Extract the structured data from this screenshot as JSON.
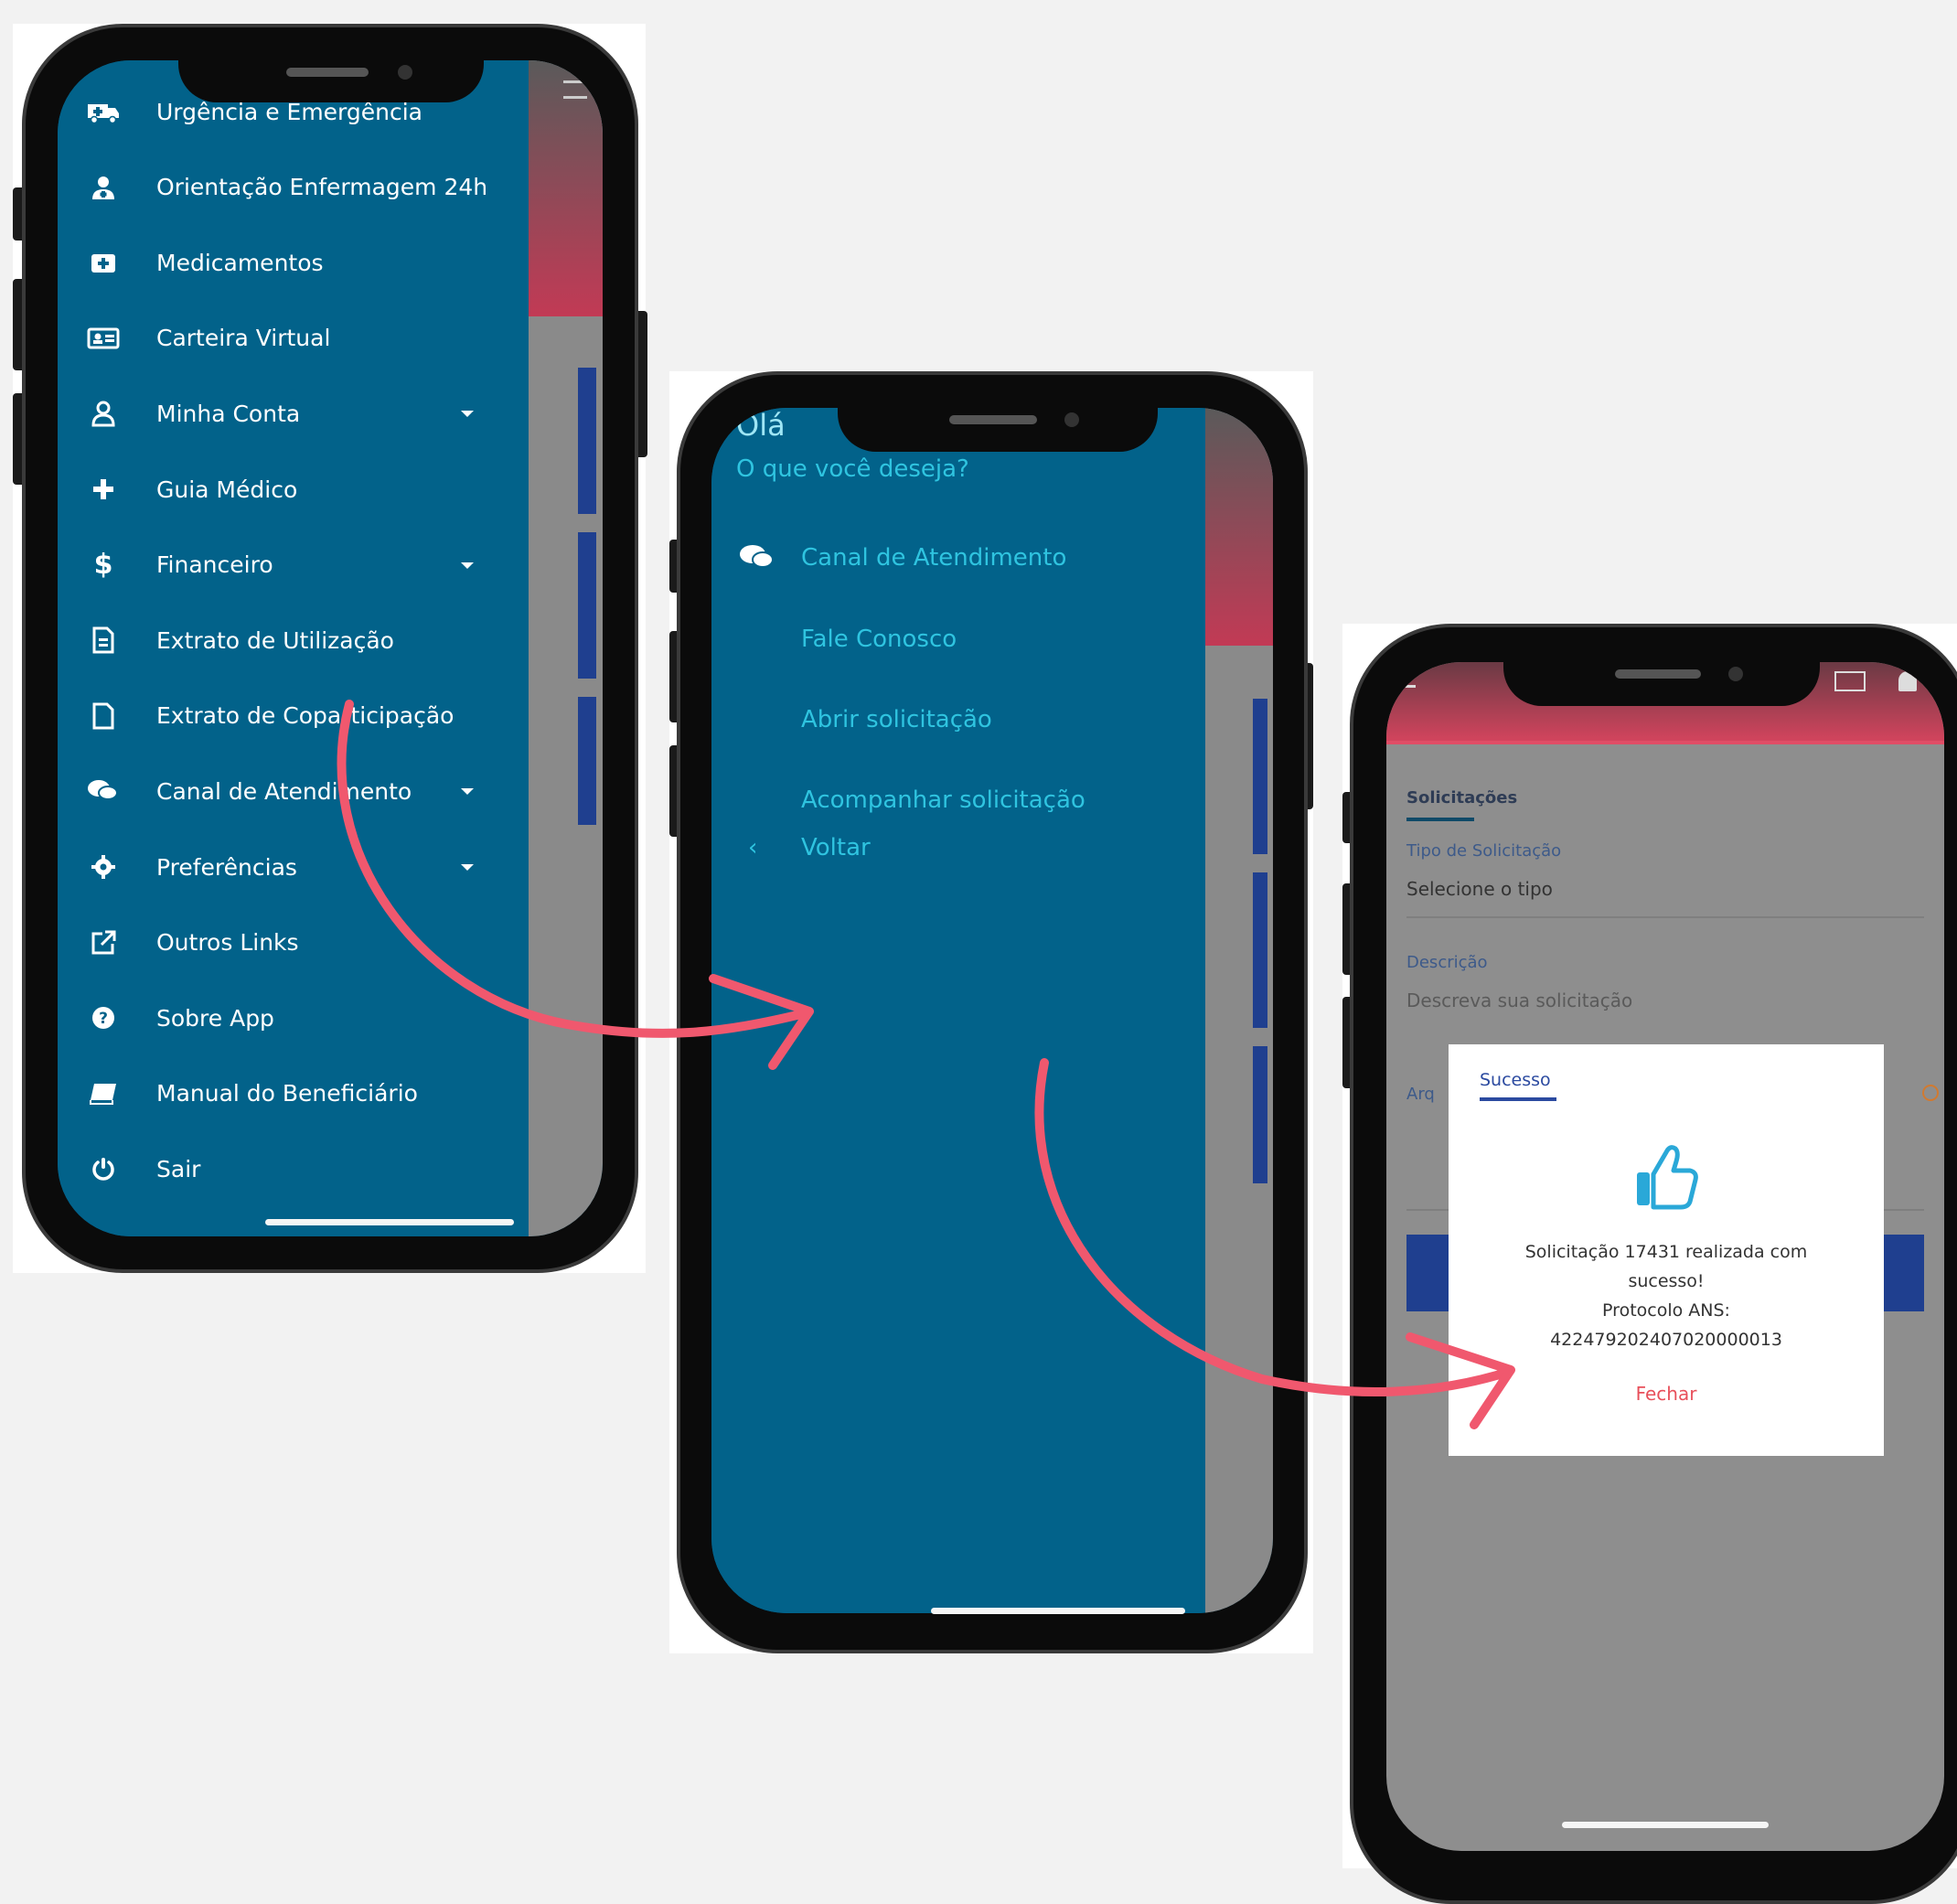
{
  "phone1": {
    "menu": [
      {
        "label": "Urgência e Emergência",
        "icon": "ambulance-icon"
      },
      {
        "label": "Orientação Enfermagem 24h",
        "icon": "nurse-icon"
      },
      {
        "label": "Medicamentos",
        "icon": "medical-kit-icon"
      },
      {
        "label": "Carteira Virtual",
        "icon": "id-card-icon"
      },
      {
        "label": "Minha Conta",
        "icon": "user-icon"
      },
      {
        "label": "Guia Médico",
        "icon": "plus-icon"
      },
      {
        "label": "Financeiro",
        "icon": "dollar-icon"
      },
      {
        "label": "Extrato de Utilização",
        "icon": "document-icon"
      },
      {
        "label": "Extrato de Coparticipação",
        "icon": "file-icon"
      },
      {
        "label": "Canal de Atendimento",
        "icon": "chat-icon"
      },
      {
        "label": "Preferências",
        "icon": "gear-icon"
      },
      {
        "label": "Outros Links",
        "icon": "external-link-icon"
      },
      {
        "label": "Sobre App",
        "icon": "question-circle-icon"
      },
      {
        "label": "Manual do Beneficiário",
        "icon": "book-icon"
      },
      {
        "label": "Sair",
        "icon": "power-icon"
      }
    ]
  },
  "phone2": {
    "greeting": "Olá",
    "prompt": "O que você deseja?",
    "section_title": "Canal de Atendimento",
    "section_icon": "chat-icon",
    "items": [
      "Fale Conosco",
      "Abrir solicitação",
      "Acompanhar solicitação"
    ],
    "back_label": "Voltar",
    "back_icon": "chevron-left-icon"
  },
  "phone3": {
    "tab_label": "Solicitações",
    "type_label": "Tipo de Solicitação",
    "type_placeholder": "Selecione o tipo",
    "desc_label": "Descrição",
    "desc_placeholder": "Descreva sua solicitação",
    "attach_label_partial": "Arq",
    "dialog": {
      "tab_label": "Sucesso",
      "icon": "thumbs-up-icon",
      "message_line1": "Solicitação 17431 realizada com",
      "message_line2": "sucesso!",
      "protocol_label": "Protocolo ANS:",
      "protocol_number": "422479202407020000013",
      "close_label": "Fechar"
    }
  },
  "colors": {
    "background": "#f2f2f2",
    "menu_blue": "#02628a",
    "accent_cyan": "#2fc4e0",
    "arrow_pink": "#f0586e",
    "close_red": "#e8505b",
    "dialog_tab_blue": "#2b4aa0"
  }
}
